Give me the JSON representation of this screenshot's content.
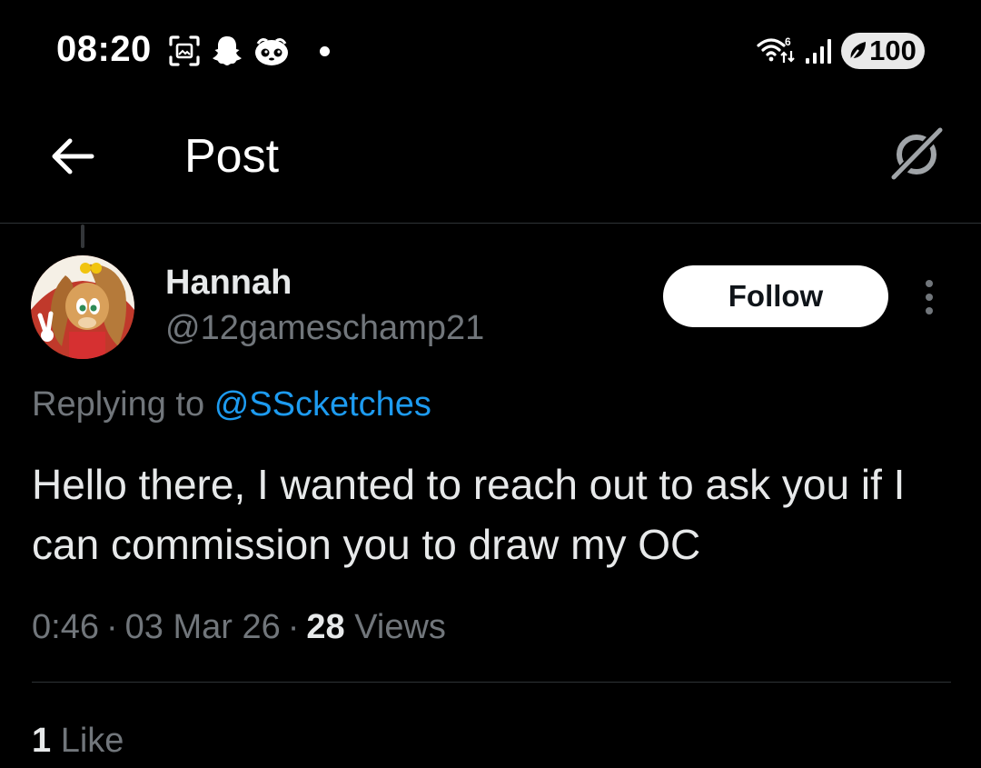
{
  "status_bar": {
    "time": "08:20",
    "battery": "100",
    "icons": [
      "screenshot-icon",
      "snapchat-icon",
      "mobile-game-icon",
      "notification-dot",
      "wifi-icon",
      "signal-icon",
      "battery-saver-icon"
    ]
  },
  "header": {
    "title": "Post",
    "back_icon": "arrow-left-icon",
    "grok_icon": "grok-icon"
  },
  "post": {
    "author_name": "Hannah",
    "author_handle": "@12gameschamp21",
    "follow_label": "Follow",
    "replying_prefix": "Replying to",
    "replying_handle": "@SScketches",
    "text": "Hello there, I wanted to reach out to ask you if I can commission you to draw my OC",
    "time": "0:46",
    "date": "03 Mar 26",
    "views_count": "28",
    "views_label": "Views",
    "likes_count": "1",
    "likes_label": "Like"
  },
  "colors": {
    "background": "#000000",
    "text_primary": "#e7e9ea",
    "text_secondary": "#71767b",
    "link": "#1d9bf0",
    "divider": "#2f3336"
  }
}
